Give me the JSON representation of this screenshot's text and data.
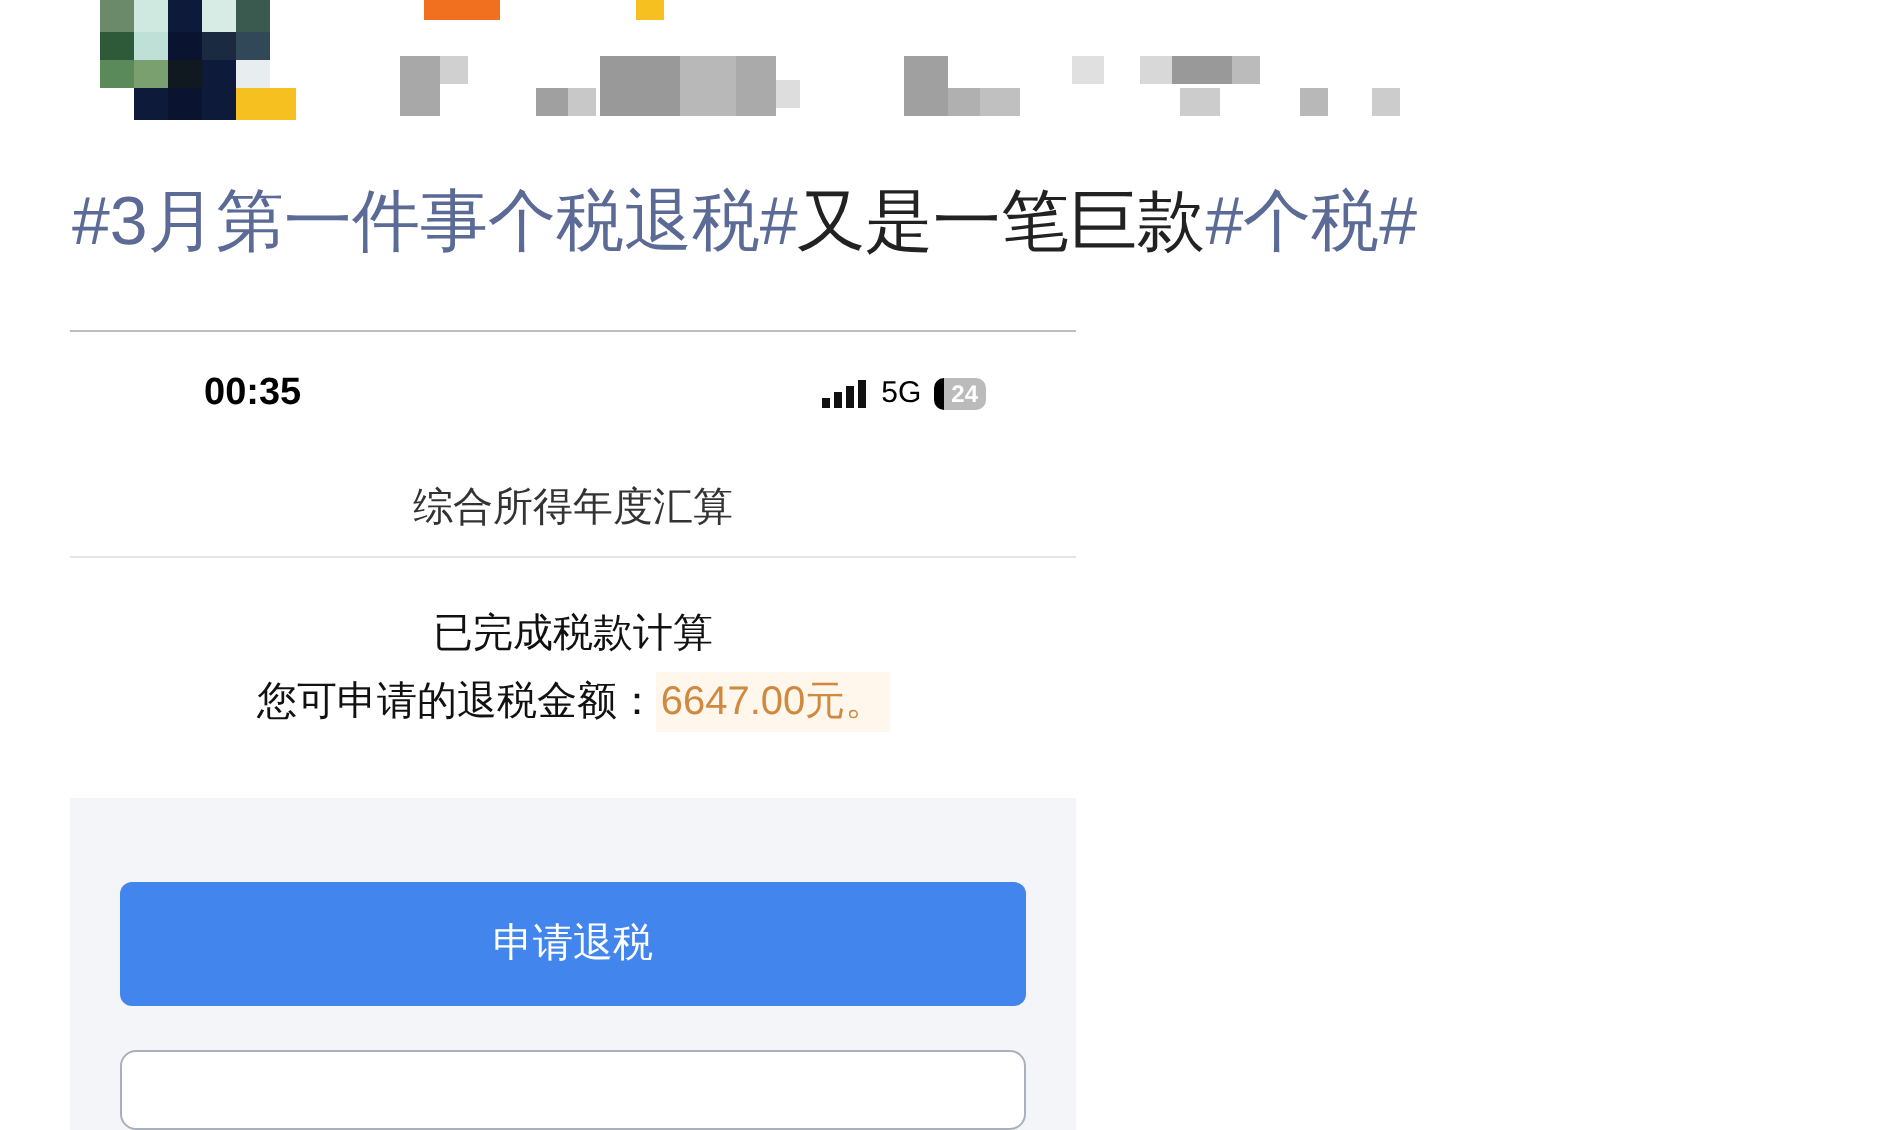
{
  "post": {
    "segments": [
      {
        "kind": "hashtag",
        "text": "#3月第一件事个税退税#"
      },
      {
        "kind": "text",
        "text": "又是一笔巨款"
      },
      {
        "kind": "hashtag",
        "text": "#个税#"
      }
    ]
  },
  "phone": {
    "status_bar": {
      "time": "00:35",
      "network": "5G",
      "battery": "24"
    },
    "title": "综合所得年度汇算",
    "message": "已完成税款计算",
    "refund_label": "您可申请的退税金额：",
    "refund_amount": "6647.00元。",
    "primary_button": "申请退税"
  }
}
